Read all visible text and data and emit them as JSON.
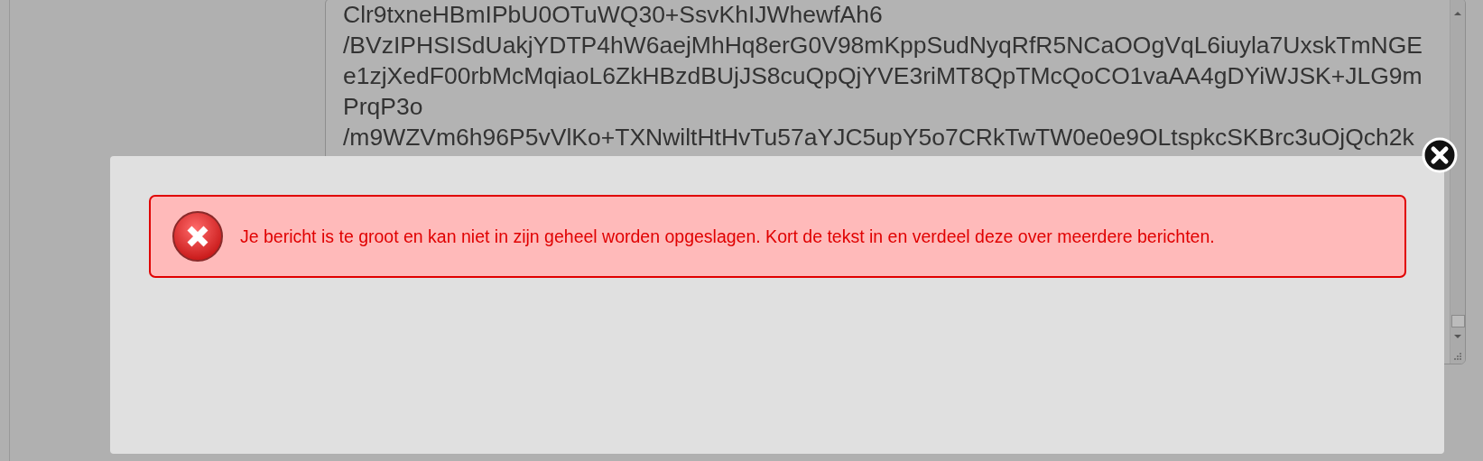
{
  "editor": {
    "lines": [
      "Clr9txneHBmIPbU0OTuWQ30+SsvKhIJWhewfAh6",
      "/BVzIPHSISdUakjYDTP4hW6aejMhHq8erG0V98mKppSudNyqRfR5NCaOOgVqL6iuyla7UxskTmNGE",
      "e1zjXedF00rbMcMqiaoL6ZkHBzdBUjJS8cuQpQjYVE3riMT8QpTMcQoCO1vaAA4gDYiWJSK+JLG9m",
      "PrqP3o",
      "/m9WZVm6h96P5vVlKo+TXNwiltHtHvTu57aYJC5upY5o7CRkTwTW0e0e9OLtspkcSKBrc3uOjQch2k"
    ]
  },
  "dialog": {
    "alert": {
      "kind": "error",
      "message": "Je bericht is te groot en kan niet in zijn geheel worden opgeslagen. Kort de tekst in en verdeel deze over meerdere berichten."
    }
  }
}
